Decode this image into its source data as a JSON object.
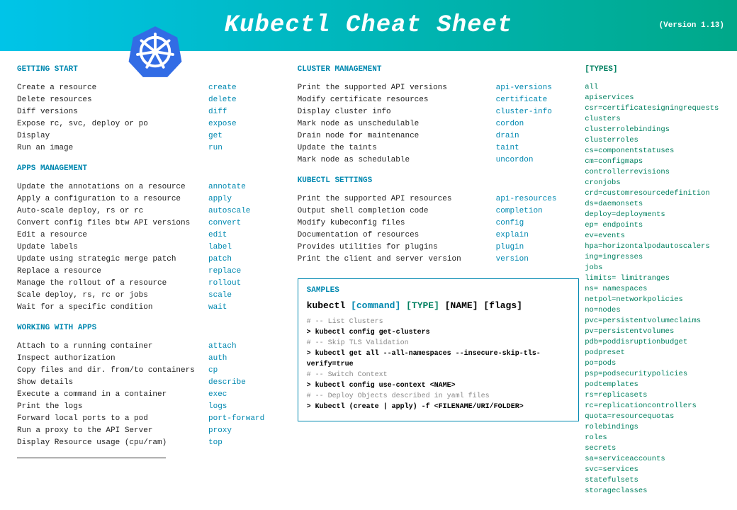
{
  "header": {
    "title": "Kubectl Cheat Sheet",
    "version": "(Version 1.13)"
  },
  "sections": {
    "getting_start": {
      "title": "GETTING START",
      "items": [
        {
          "desc": "Create a resource",
          "cmd": "create"
        },
        {
          "desc": "Delete resources",
          "cmd": "delete"
        },
        {
          "desc": "Diff versions",
          "cmd": "diff"
        },
        {
          "desc": "Expose rc, svc, deploy or po",
          "cmd": "expose"
        },
        {
          "desc": "Display",
          "cmd": "get"
        },
        {
          "desc": "Run an image",
          "cmd": "run"
        }
      ]
    },
    "apps_mgmt": {
      "title": "APPS MANAGEMENT",
      "items": [
        {
          "desc": "Update the annotations on a resource",
          "cmd": "annotate"
        },
        {
          "desc": "Apply a configuration to a resource",
          "cmd": "apply"
        },
        {
          "desc": "Auto-scale deploy, rs or rc",
          "cmd": "autoscale"
        },
        {
          "desc": "Convert config files btw API versions",
          "cmd": "convert"
        },
        {
          "desc": "Edit a resource",
          "cmd": "edit"
        },
        {
          "desc": "Update labels",
          "cmd": "label"
        },
        {
          "desc": "Update using strategic merge patch",
          "cmd": "patch"
        },
        {
          "desc": "Replace a resource",
          "cmd": "replace"
        },
        {
          "desc": "Manage the rollout of a resource",
          "cmd": "rollout"
        },
        {
          "desc": "Scale deploy, rs, rc or jobs",
          "cmd": "scale"
        },
        {
          "desc": "Wait for a specific condition",
          "cmd": "wait"
        }
      ]
    },
    "working_apps": {
      "title": "WORKING WITH APPS",
      "items": [
        {
          "desc": "Attach to a running container",
          "cmd": "attach"
        },
        {
          "desc": "Inspect authorization",
          "cmd": "auth"
        },
        {
          "desc": "Copy files and dir. from/to containers",
          "cmd": "cp"
        },
        {
          "desc": "Show details",
          "cmd": "describe"
        },
        {
          "desc": "Execute a command in a container",
          "cmd": "exec"
        },
        {
          "desc": "Print the logs",
          "cmd": "logs"
        },
        {
          "desc": "Forward local ports to a pod",
          "cmd": "port-forward"
        },
        {
          "desc": "Run a proxy to the API Server",
          "cmd": "proxy"
        },
        {
          "desc": "Display Resource usage (cpu/ram)",
          "cmd": "top"
        }
      ]
    },
    "cluster_mgmt": {
      "title": "CLUSTER MANAGEMENT",
      "items": [
        {
          "desc": "Print the supported API versions",
          "cmd": "api-versions"
        },
        {
          "desc": "Modify certificate resources",
          "cmd": "certificate"
        },
        {
          "desc": "Display cluster info",
          "cmd": "cluster-info"
        },
        {
          "desc": "Mark node as unschedulable",
          "cmd": "cordon"
        },
        {
          "desc": "Drain node for maintenance",
          "cmd": "drain"
        },
        {
          "desc": "Update the taints",
          "cmd": "taint"
        },
        {
          "desc": "Mark node as schedulable",
          "cmd": "uncordon"
        }
      ]
    },
    "kubectl_settings": {
      "title": "KUBECTL SETTINGS",
      "items": [
        {
          "desc": "Print the supported API resources",
          "cmd": "api-resources"
        },
        {
          "desc": "Output shell completion code",
          "cmd": "completion"
        },
        {
          "desc": "Modify kubeconfig files",
          "cmd": "config"
        },
        {
          "desc": "Documentation of resources",
          "cmd": "explain"
        },
        {
          "desc": "Provides utilities for plugins",
          "cmd": "plugin"
        },
        {
          "desc": "Print the client and server version",
          "cmd": "version"
        }
      ]
    }
  },
  "samples": {
    "title": "SAMPLES",
    "usage": {
      "kubectl": "kubectl",
      "command": "[command]",
      "type": "[TYPE]",
      "name": "[NAME]",
      "flags": "[flags]"
    },
    "lines": [
      {
        "comment": "# -- List Clusters",
        "code": "> kubectl config get-clusters"
      },
      {
        "comment": "# -- Skip TLS Validation",
        "code": "> kubectl get all --all-namespaces --insecure-skip-tls-verify=true"
      },
      {
        "comment": "# -- Switch Context",
        "code": "> kubectl config use-context <NAME>"
      },
      {
        "comment": "# -- Deploy Objects described in yaml files",
        "code": "> Kubectl (create | apply) -f <FILENAME/URI/FOLDER>"
      }
    ]
  },
  "types": {
    "title": "[TYPES]",
    "items": [
      "all",
      "apiservices",
      "csr=certificatesigningrequests",
      "clusters",
      "clusterrolebindings",
      "clusterroles",
      "cs=componentstatuses",
      "cm=configmaps",
      "controllerrevisions",
      "cronjobs",
      "crd=customresourcedefinition",
      "ds=daemonsets",
      "deploy=deployments",
      "ep= endpoints",
      "ev=events",
      "hpa=horizontalpodautoscalers",
      "ing=ingresses",
      "jobs",
      "limits= limitranges",
      "ns= namespaces",
      "netpol=networkpolicies",
      "no=nodes",
      "pvc=persistentvolumeclaims",
      "pv=persistentvolumes",
      "pdb=poddisruptionbudget",
      "podpreset",
      "po=pods",
      "psp=podsecuritypolicies",
      "podtemplates",
      "rs=replicasets",
      "rc=replicationcontrollers",
      "quota=resourcequotas",
      "rolebindings",
      "roles",
      "secrets",
      "sa=serviceaccounts",
      "svc=services",
      "statefulsets",
      "storageclasses"
    ]
  }
}
